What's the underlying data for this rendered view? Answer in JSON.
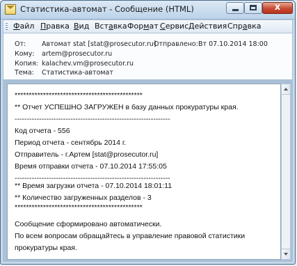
{
  "window": {
    "title": "Статистика-автомат - Сообщение (HTML)",
    "close_glyph": "x"
  },
  "menu": {
    "items": [
      {
        "label": "Файл",
        "accel": "Ф",
        "rest": "айл"
      },
      {
        "label": "Правка",
        "accel": "П",
        "rest": "равка"
      },
      {
        "label": "Вид",
        "accel": "В",
        "rest": "ид"
      },
      {
        "label": "Вставка",
        "pre": "Вст",
        "accel": "а",
        "rest": "вка"
      },
      {
        "label": "Формат",
        "pre": "Фор",
        "accel": "м",
        "rest": "ат"
      },
      {
        "label": "Сервис",
        "accel": "С",
        "rest": "ервис"
      },
      {
        "label": "Действия",
        "accel": "Д",
        "rest": "ействия"
      },
      {
        "label": "Справка",
        "pre": "Спр",
        "accel": "а",
        "rest": "вка"
      }
    ]
  },
  "header": {
    "from_label": "От:",
    "from_value": "Автомат stat [stat@prosecutor.ru]",
    "sent_label": "Отправлено:",
    "sent_value": "Вт 07.10.2014 18:00",
    "to_label": "Кому:",
    "to_value": "artem@prosecutor.ru",
    "cc_label": "Копия:",
    "cc_value": "kalachev.vm@prosecutor.ru",
    "subject_label": "Тема:",
    "subject_value": "Статистика-автомат"
  },
  "message": {
    "lines": [
      "*********************************************",
      "** Отчет УСПЕШНО ЗАГРУЖЕН в базу данных прокуратуры края.",
      "----------------------------------------------------------------",
      "Код отчета - 556",
      "Период отчета - сентябрь 2014 г.",
      "Отправитель - г.Артем [stat@prosecutor.ru]",
      "Время отправки отчета - 07.10.2014 17:55:05",
      "----------------------------------------------------------------",
      "** Время загрузки отчета - 07.10.2014 18:01:11",
      "** Количество загруженных разделов - 3",
      "*********************************************",
      "",
      "Сообщение сформировано автоматически.",
      "По всем вопросам обращайтесь в управление правовой статистики",
      "прокуратуры края."
    ]
  }
}
